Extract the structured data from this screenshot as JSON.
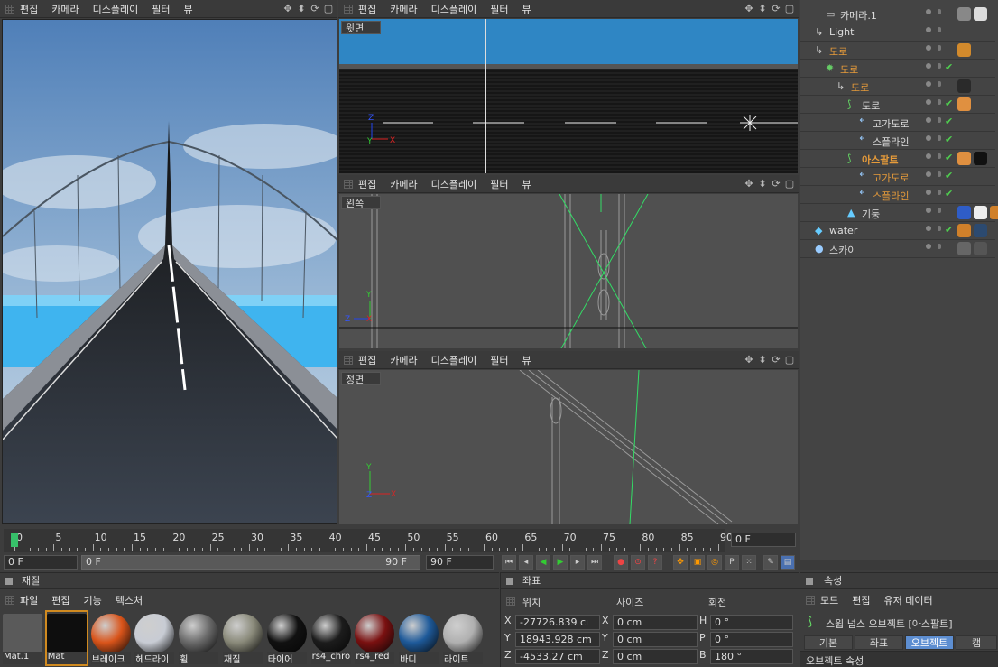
{
  "viewport_menu": {
    "edit": "편집",
    "camera": "카메라",
    "display": "디스플레이",
    "filter": "필터",
    "view": "뷰"
  },
  "views": {
    "top": "윗면",
    "left": "왼쪽",
    "front": "정면"
  },
  "axes": {
    "x": "X",
    "y": "Y",
    "z": "Z"
  },
  "objects": [
    {
      "name": "카메라.1",
      "style": "normal"
    },
    {
      "name": "Light",
      "style": "normal"
    },
    {
      "name": "도로",
      "style": "orange"
    },
    {
      "name": "도로",
      "style": "orange"
    },
    {
      "name": "도로",
      "style": "orange"
    },
    {
      "name": "도로",
      "style": "normal"
    },
    {
      "name": "고가도로",
      "style": "normal"
    },
    {
      "name": "스플라인",
      "style": "normal"
    },
    {
      "name": "아스팔트",
      "style": "orange-bold"
    },
    {
      "name": "고가도로",
      "style": "orange"
    },
    {
      "name": "스플라인",
      "style": "orange"
    },
    {
      "name": "기둥",
      "style": "normal"
    },
    {
      "name": "water",
      "style": "normal"
    },
    {
      "name": "스카이",
      "style": "normal"
    }
  ],
  "timeline": {
    "ticks": [
      "0",
      "5",
      "10",
      "15",
      "20",
      "25",
      "30",
      "35",
      "40",
      "45",
      "50",
      "55",
      "60",
      "65",
      "70",
      "75",
      "80",
      "85",
      "90"
    ],
    "current_frame": "0 F",
    "start": "0 F",
    "range_start": "0 F",
    "range_end": "90 F",
    "end": "90 F"
  },
  "materials_panel": {
    "title": "재질",
    "menu": {
      "file": "파일",
      "edit": "편집",
      "function": "기능",
      "texture": "텍스처"
    },
    "items": [
      {
        "label": "Mat.1",
        "color": "#5a5a5a"
      },
      {
        "label": "Mat",
        "color": "#0e0e0e"
      },
      {
        "label": "브레이크",
        "color": "#d9541a"
      },
      {
        "label": "헤드라이",
        "color": "#c8ccd4"
      },
      {
        "label": "휠",
        "color": "#6a6a6a"
      },
      {
        "label": "재질",
        "color": "#8a8a7a"
      },
      {
        "label": "타이어",
        "color": "#111111"
      },
      {
        "label": "rs4_chro",
        "color": "#1c1c1c"
      },
      {
        "label": "rs4_red",
        "color": "#7a1010"
      },
      {
        "label": "바디",
        "color": "#1e5a9a"
      },
      {
        "label": "라이트",
        "color": "#b0b0b0"
      }
    ]
  },
  "coords": {
    "title": "좌표",
    "col_position": "위치",
    "col_size": "사이즈",
    "col_rotation": "회전",
    "rows": [
      {
        "axis": "X",
        "pos": "-27726.839 cı",
        "size_axis": "X",
        "size": "0 cm",
        "rot_axis": "H",
        "rot": "0 °"
      },
      {
        "axis": "Y",
        "pos": "18943.928 cm",
        "size_axis": "Y",
        "size": "0 cm",
        "rot_axis": "P",
        "rot": "0 °"
      },
      {
        "axis": "Z",
        "pos": "-4533.27 cm",
        "size_axis": "Z",
        "size": "0 cm",
        "rot_axis": "B",
        "rot": "180 °"
      }
    ]
  },
  "attributes": {
    "title": "속성",
    "menu": {
      "mode": "모드",
      "edit": "편집",
      "userdata": "유저 데이터"
    },
    "object_title": "스윕 넙스 오브젝트 [아스팔트]",
    "tabs": [
      "기본",
      "좌표",
      "오브젝트",
      "캡"
    ],
    "section": "오브젝트 속성"
  }
}
